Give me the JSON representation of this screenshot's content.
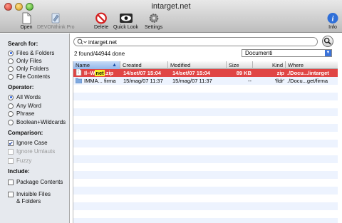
{
  "window": {
    "title": "intarget.net"
  },
  "toolbar": {
    "open_label": "Open",
    "devonthink_label": "DEVONthink Pro",
    "delete_label": "Delete",
    "quicklook_label": "Quick Look",
    "settings_label": "Settings",
    "info_label": "Info"
  },
  "sidebar": {
    "search_for": {
      "heading": "Search for:",
      "options": [
        "Files & Folders",
        "Only Files",
        "Only Folders",
        "File Contents"
      ],
      "selected": "Files & Folders"
    },
    "operator": {
      "heading": "Operator:",
      "options": [
        "All Words",
        "Any Word",
        "Phrase",
        "Boolean+Wildcards"
      ],
      "selected": "All Words"
    },
    "comparison": {
      "heading": "Comparison:",
      "ignore_case": "Ignore Case",
      "ignore_umlauts": "Ignore Umlauts",
      "fuzzy": "Fuzzy"
    },
    "include": {
      "heading": "Include:",
      "package_contents": "Package Contents",
      "invisible_line1": "Invisible Files",
      "invisible_line2": "& Folders"
    }
  },
  "search": {
    "query": "intarget.net",
    "status": "2 found/44944 done",
    "scope": "Documenti"
  },
  "table": {
    "columns": {
      "name": "Name",
      "created": "Created",
      "modified": "Modified",
      "size": "Size",
      "kind": "Kind",
      "where": "Where"
    },
    "rows": [
      {
        "name_prefix": "Il–W",
        "name_highlight": "net",
        "name_suffix": ".zip",
        "created": "14/set/07 15:04",
        "modified": "14/set/07 15:04",
        "size": "89 KB",
        "kind": "zip",
        "where": "./Docu.../intarget",
        "selected": true
      },
      {
        "name_prefix": "IMMA...",
        "name_highlight": "",
        "name_suffix": "firma",
        "created": "15/mag/07 11:37",
        "modified": "15/mag/07 11:37",
        "size": "--",
        "kind": "'fldr'",
        "where": "./Docu...get/firma",
        "selected": false
      }
    ]
  },
  "colors": {
    "selection": "#e04545",
    "highlight": "#f7ef2a",
    "accent": "#3b73d9"
  }
}
